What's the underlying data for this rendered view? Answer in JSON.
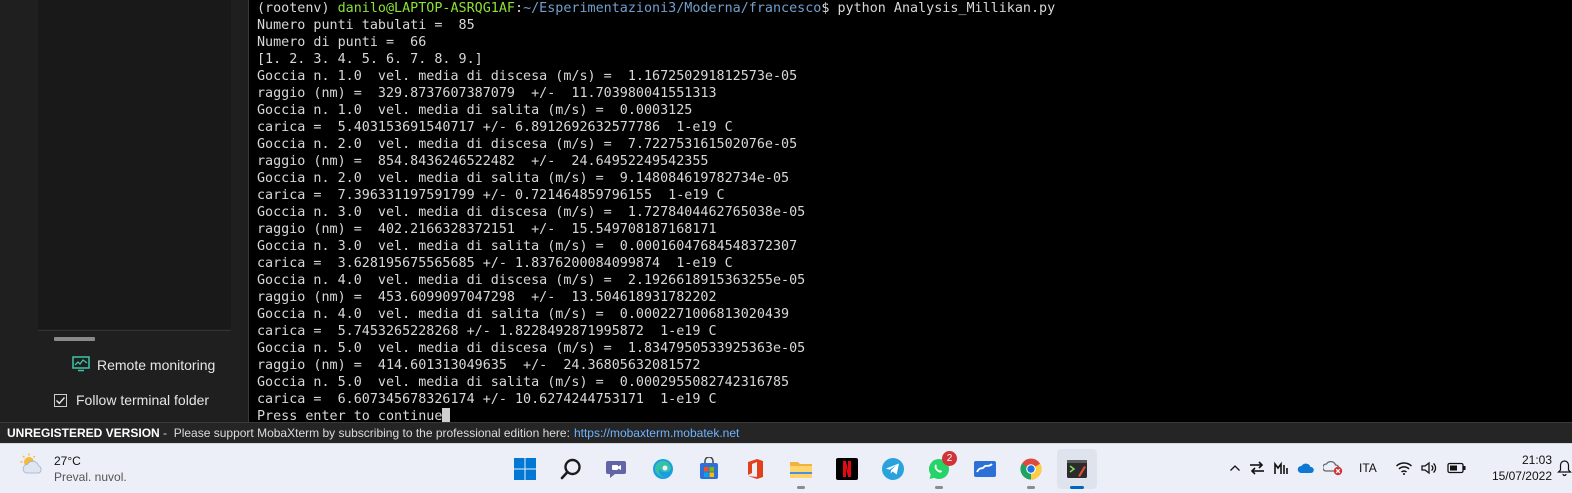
{
  "sidebar": {
    "remote_monitoring_label": "Remote monitoring",
    "follow_folder_label": "Follow terminal folder",
    "follow_folder_checked": true
  },
  "terminal": {
    "prompt": {
      "env": "(rootenv)",
      "user_host": "danilo@LAPTOP-ASRQG1AF",
      "path": "~/Esperimentazioni3/Moderna/francesco",
      "command": "$ python Analysis_Millikan.py"
    },
    "lines": [
      "Numero punti tabulati =  85",
      "Numero di punti =  66",
      "[1. 2. 3. 4. 5. 6. 7. 8. 9.]",
      "Goccia n. 1.0  vel. media di discesa (m/s) =  1.167250291812573e-05",
      "raggio (nm) =  329.8737607387079  +/-  11.703980041551313",
      "Goccia n. 1.0  vel. media di salita (m/s) =  0.0003125",
      "carica =  5.403153691540717 +/- 6.8912692632577786  1-e19 C",
      "Goccia n. 2.0  vel. media di discesa (m/s) =  7.722753161502076e-05",
      "raggio (nm) =  854.8436246522482  +/-  24.64952249542355",
      "Goccia n. 2.0  vel. media di salita (m/s) =  9.148084619782734e-05",
      "carica =  7.396331197591799 +/- 0.721464859796155  1-e19 C",
      "Goccia n. 3.0  vel. media di discesa (m/s) =  1.7278404462765038e-05",
      "raggio (nm) =  402.2166328372151  +/-  15.549708187168171",
      "Goccia n. 3.0  vel. media di salita (m/s) =  0.00016047684548372307",
      "carica =  3.628195675565685 +/- 1.8376200084099874  1-e19 C",
      "Goccia n. 4.0  vel. media di discesa (m/s) =  2.1926618915363255e-05",
      "raggio (nm) =  453.6099097047298  +/-  13.504618931782202",
      "Goccia n. 4.0  vel. media di salita (m/s) =  0.0002271006813020439",
      "carica =  5.7453265228268 +/- 1.8228492871995872  1-e19 C",
      "Goccia n. 5.0  vel. media di discesa (m/s) =  1.8347950533925363e-05",
      "raggio (nm) =  414.601313049635  +/-  24.36805632081572",
      "Goccia n. 5.0  vel. media di salita (m/s) =  0.0002955082742316785",
      "carica =  6.607345678326174 +/- 10.6274244753171  1-e19 C"
    ],
    "last_line": "Press enter to continue"
  },
  "banner": {
    "title": "UNREGISTERED VERSION",
    "text": " -  Please support MobaXterm by subscribing to the professional edition here:",
    "link": "https://mobaxterm.mobatek.net"
  },
  "taskbar": {
    "weather": {
      "temp": "27°C",
      "desc": "Preval. nuvol."
    },
    "apps": [
      {
        "name": "start",
        "icon": "windows-logo"
      },
      {
        "name": "search",
        "icon": "search-icon"
      },
      {
        "name": "teams-chat",
        "icon": "chat-icon"
      },
      {
        "name": "edge",
        "icon": "edge-icon"
      },
      {
        "name": "microsoft-store",
        "icon": "store-icon"
      },
      {
        "name": "office",
        "icon": "office-icon"
      },
      {
        "name": "file-explorer",
        "icon": "folder-icon"
      },
      {
        "name": "netflix",
        "icon": "netflix-icon"
      },
      {
        "name": "telegram",
        "icon": "telegram-icon"
      },
      {
        "name": "whatsapp",
        "icon": "whatsapp-icon",
        "badge": "2"
      },
      {
        "name": "whiteboard",
        "icon": "whiteboard-icon"
      },
      {
        "name": "chrome",
        "icon": "chrome-icon"
      },
      {
        "name": "mobaxterm",
        "icon": "mobaxterm-icon"
      }
    ],
    "tray": {
      "language": "ITA"
    },
    "clock": {
      "time": "21:03",
      "date": "15/07/2022"
    }
  },
  "colors": {
    "terminal_bg": "#000000",
    "prompt_green": "#8ae234",
    "prompt_blue": "#729fcf",
    "taskbar_bg": "#eceff7",
    "accent": "#0067c0"
  }
}
